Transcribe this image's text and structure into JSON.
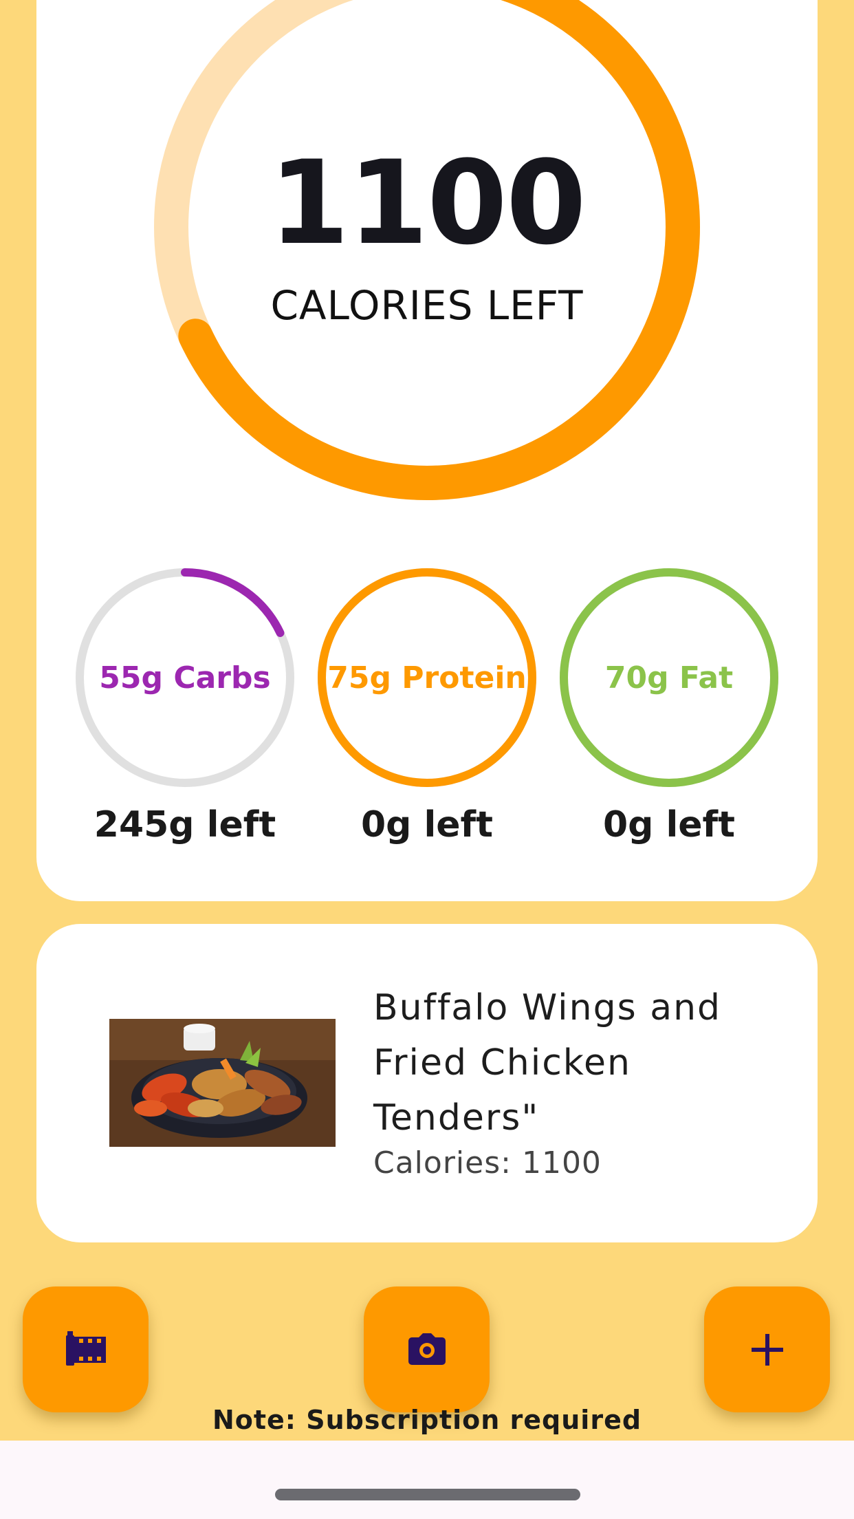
{
  "calories": {
    "value": "1100",
    "label": "CALORIES LEFT",
    "progress": 0.68
  },
  "macros": [
    {
      "name": "55g Carbs",
      "left": "245g left",
      "color": "#9c27b0",
      "progress": 0.18
    },
    {
      "name": "75g Protein",
      "left": "0g left",
      "color": "#fe9900",
      "progress": 1.0
    },
    {
      "name": "70g Fat",
      "left": "0g left",
      "color": "#8bc34a",
      "progress": 1.0
    }
  ],
  "meal": {
    "title": "Buffalo Wings and Fried Chicken Tenders\"",
    "calories": "Calories: 1100"
  },
  "buttons": {
    "gallery_icon": "film-roll-icon",
    "camera_icon": "camera-icon",
    "add_icon": "plus-icon"
  },
  "note": "Note: Subscription required",
  "colors": {
    "background": "#fdd87a",
    "accent": "#fe9900",
    "ring_track": "#fee0b2",
    "icon": "#2a1262"
  }
}
